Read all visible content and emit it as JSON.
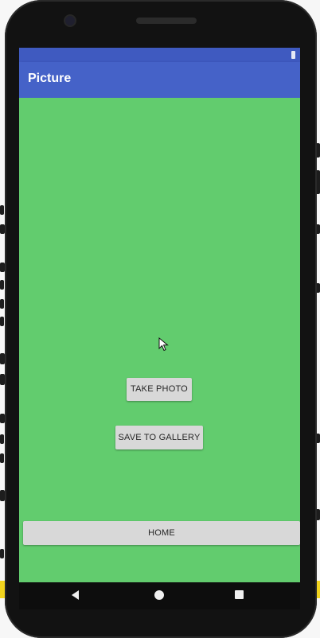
{
  "app_bar": {
    "title": "Picture"
  },
  "buttons": {
    "take_photo": "TAKE PHOTO",
    "save_to_gallery": "SAVE TO GALLERY",
    "home": "HOME"
  },
  "colors": {
    "content_background": "#62cc6e",
    "app_bar": "#4562c8",
    "status_bar": "#3f5ac0",
    "button": "#d8d8d8"
  },
  "icons": {
    "status": "battery-icon",
    "cursor": "mouse-pointer-icon",
    "nav_back": "back-triangle-icon",
    "nav_home": "home-circle-icon",
    "nav_recents": "recents-square-icon"
  }
}
